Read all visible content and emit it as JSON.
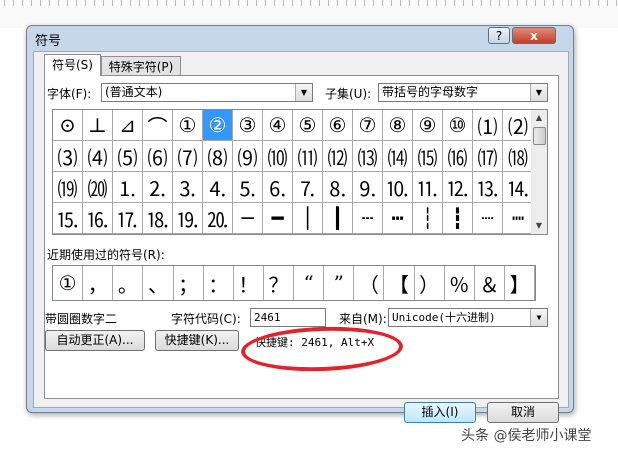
{
  "dialog": {
    "title": "符号",
    "help_label": "?",
    "close_label": "x"
  },
  "tabs": [
    {
      "label": "符号(S)"
    },
    {
      "label": "特殊字符(P)"
    }
  ],
  "font": {
    "label": "字体(F):",
    "value": "(普通文本)"
  },
  "subset": {
    "label": "子集(U):",
    "value": "带括号的字母数字"
  },
  "grid": [
    [
      "⊙",
      "⊥",
      "⊿",
      "⌒",
      "①",
      "②",
      "③",
      "④",
      "⑤",
      "⑥",
      "⑦",
      "⑧",
      "⑨",
      "⑩",
      "⑴",
      "⑵"
    ],
    [
      "⑶",
      "⑷",
      "⑸",
      "⑹",
      "⑺",
      "⑻",
      "⑼",
      "⑽",
      "⑾",
      "⑿",
      "⒀",
      "⒁",
      "⒂",
      "⒃",
      "⒄",
      "⒅"
    ],
    [
      "⒆",
      "⒇",
      "⒈",
      "⒉",
      "⒊",
      "⒋",
      "⒌",
      "⒍",
      "⒎",
      "⒏",
      "⒐",
      "⒑",
      "⒒",
      "⒓",
      "⒔",
      "⒕"
    ],
    [
      "⒖",
      "⒗",
      "⒘",
      "⒙",
      "⒚",
      "⒛",
      "─",
      "━",
      "│",
      "┃",
      "┄",
      "┅",
      "┆",
      "┇",
      "┈",
      "┉"
    ]
  ],
  "selected_symbol": "②",
  "recent": {
    "label": "近期使用过的符号(R):",
    "items": [
      "①",
      "，",
      "。",
      "、",
      "；",
      "：",
      "！",
      "？",
      "“",
      "”",
      "（",
      "【",
      "）",
      "％",
      "＆",
      "】"
    ]
  },
  "char_name": "带圆圈数字二",
  "char_code": {
    "label": "字符代码(C):",
    "value": "2461"
  },
  "from": {
    "label": "来自(M):",
    "value": "Unicode(十六进制)"
  },
  "buttons": {
    "autocorrect": "自动更正(A)...",
    "shortcut_key": "快捷键(K)...",
    "insert": "插入(I)",
    "cancel": "取消"
  },
  "shortcut_text": "快捷键: 2461, Alt+X",
  "annotation_color": "#e0242b",
  "watermark": "头条 @侯老师小课堂"
}
